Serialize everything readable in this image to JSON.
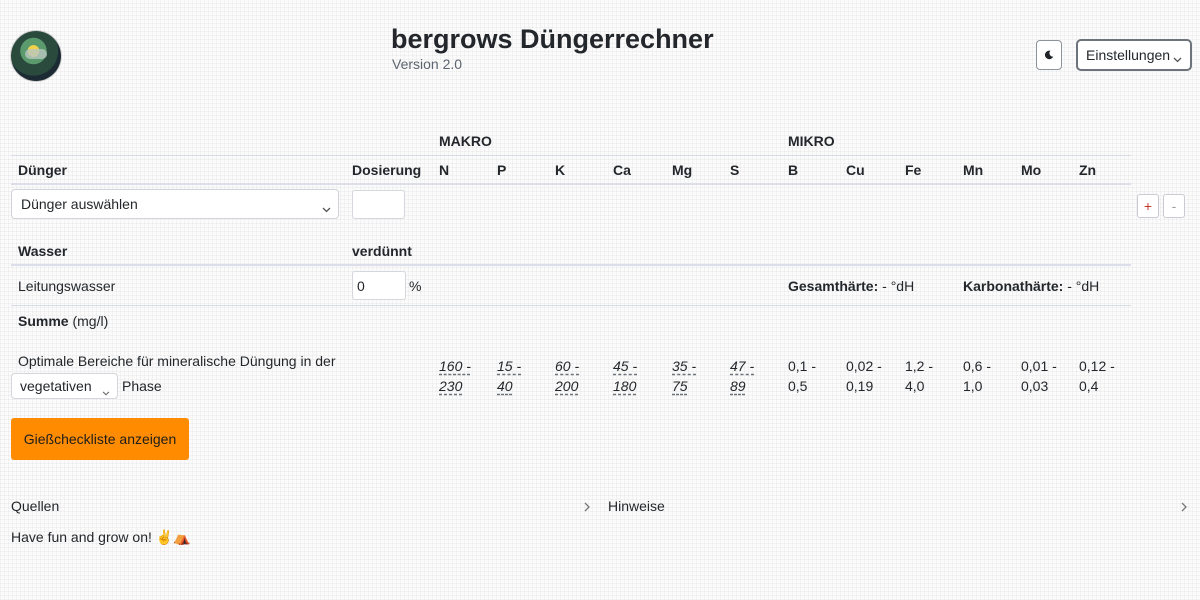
{
  "header": {
    "title": "bergrows Düngerrechner",
    "version": "Version 2.0",
    "settings_label": "Einstellungen",
    "theme_icon": "moon-icon"
  },
  "table": {
    "group_headers": {
      "makro": "MAKRO",
      "mikro": "MIKRO"
    },
    "col_duenger": "Dünger",
    "col_dosierung": "Dosierung",
    "makro_cols": [
      "N",
      "P",
      "K",
      "Ca",
      "Mg",
      "S"
    ],
    "mikro_cols": [
      "B",
      "Cu",
      "Fe",
      "Mn",
      "Mo",
      "Zn"
    ],
    "fertilizer_select": "Dünger auswählen",
    "dosage_value": "",
    "add_button": "+",
    "remove_button": "-"
  },
  "water": {
    "header": "Wasser",
    "diluted_header": "verdünnt",
    "source": "Leitungswasser",
    "diluted_value": "0",
    "percent": "%",
    "gesamthaerte_label": "Gesamthärte:",
    "gesamthaerte_value": "- °dH",
    "karbonathaerte_label": "Karbonathärte:",
    "karbonathaerte_value": "- °dH"
  },
  "summe": {
    "label": "Summe",
    "unit": "(mg/l)"
  },
  "optimal": {
    "text": "Optimale Bereiche für mineralische Düngung in der",
    "phase": "vegetativen",
    "phase_suffix": "Phase",
    "makro_ranges": [
      [
        "160 -",
        "230"
      ],
      [
        "15 -",
        "40"
      ],
      [
        "60 -",
        "200"
      ],
      [
        "45 -",
        "180"
      ],
      [
        "35 -",
        "75"
      ],
      [
        "47 -",
        "89"
      ]
    ],
    "mikro_ranges": [
      [
        "0,1 -",
        "0,5"
      ],
      [
        "0,02 -",
        "0,19"
      ],
      [
        "1,2 -",
        "4,0"
      ],
      [
        "0,6 -",
        "1,0"
      ],
      [
        "0,01 -",
        "0,03"
      ],
      [
        "0,12 -",
        "0,4"
      ]
    ]
  },
  "checklist_button": "Gießcheckliste anzeigen",
  "footer": {
    "quellen": "Quellen",
    "hinweise": "Hinweise",
    "fun": "Have fun and grow on! ✌️⛺"
  },
  "colors": {
    "accent": "#ff8c00",
    "plus": "#c0392b"
  }
}
